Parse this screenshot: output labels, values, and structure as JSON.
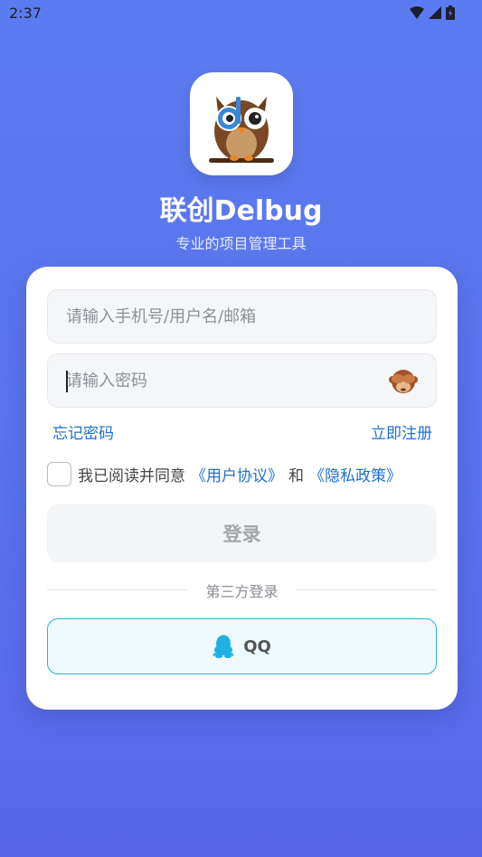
{
  "status_bar": {
    "time": "2:37"
  },
  "app": {
    "title": "联创Delbug",
    "subtitle": "专业的项目管理工具",
    "logo_icon": "owl-logo"
  },
  "form": {
    "username_placeholder": "请输入手机号/用户名/邮箱",
    "password_placeholder": "请输入密码",
    "password_toggle_icon": "see-no-evil-monkey-icon",
    "forgot_password": "忘记密码",
    "register": "立即注册",
    "agree_prefix": "我已阅读并同意",
    "user_agreement": "《用户协议》",
    "agree_and": "和",
    "privacy_policy": "《隐私政策》",
    "login_button": "登录"
  },
  "third_party": {
    "divider_label": "第三方登录",
    "qq_label": "QQ",
    "qq_icon": "qq-penguin-icon"
  },
  "colors": {
    "background": "#5b7cf0",
    "link": "#1f6fd0",
    "qq_border": "#26b2d8",
    "qq_icon": "#1fb0e6"
  }
}
